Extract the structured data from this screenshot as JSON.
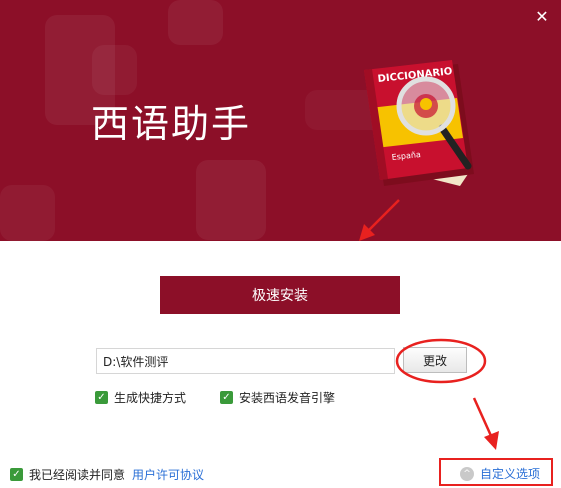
{
  "window": {
    "close_glyph": "✕"
  },
  "banner": {
    "app_title": "西语助手",
    "book": {
      "title": "DICCIONARIO",
      "subtitle": "España"
    }
  },
  "main": {
    "install_label": "极速安装",
    "install_path": "D:\\软件测评",
    "change_label": "更改",
    "options": [
      {
        "label": "生成快捷方式",
        "checked": true
      },
      {
        "label": "安装西语发音引擎",
        "checked": true
      }
    ]
  },
  "footer": {
    "agree_label": "我已经阅读并同意",
    "agree_checked": true,
    "license_link": "用户许可协议",
    "custom_label": "自定义选项",
    "custom_icon": "^"
  },
  "colors": {
    "brand": "#8c0f28",
    "checkbox": "#3a9a3a",
    "link": "#2a6fd6",
    "annotation": "#e8211f"
  }
}
